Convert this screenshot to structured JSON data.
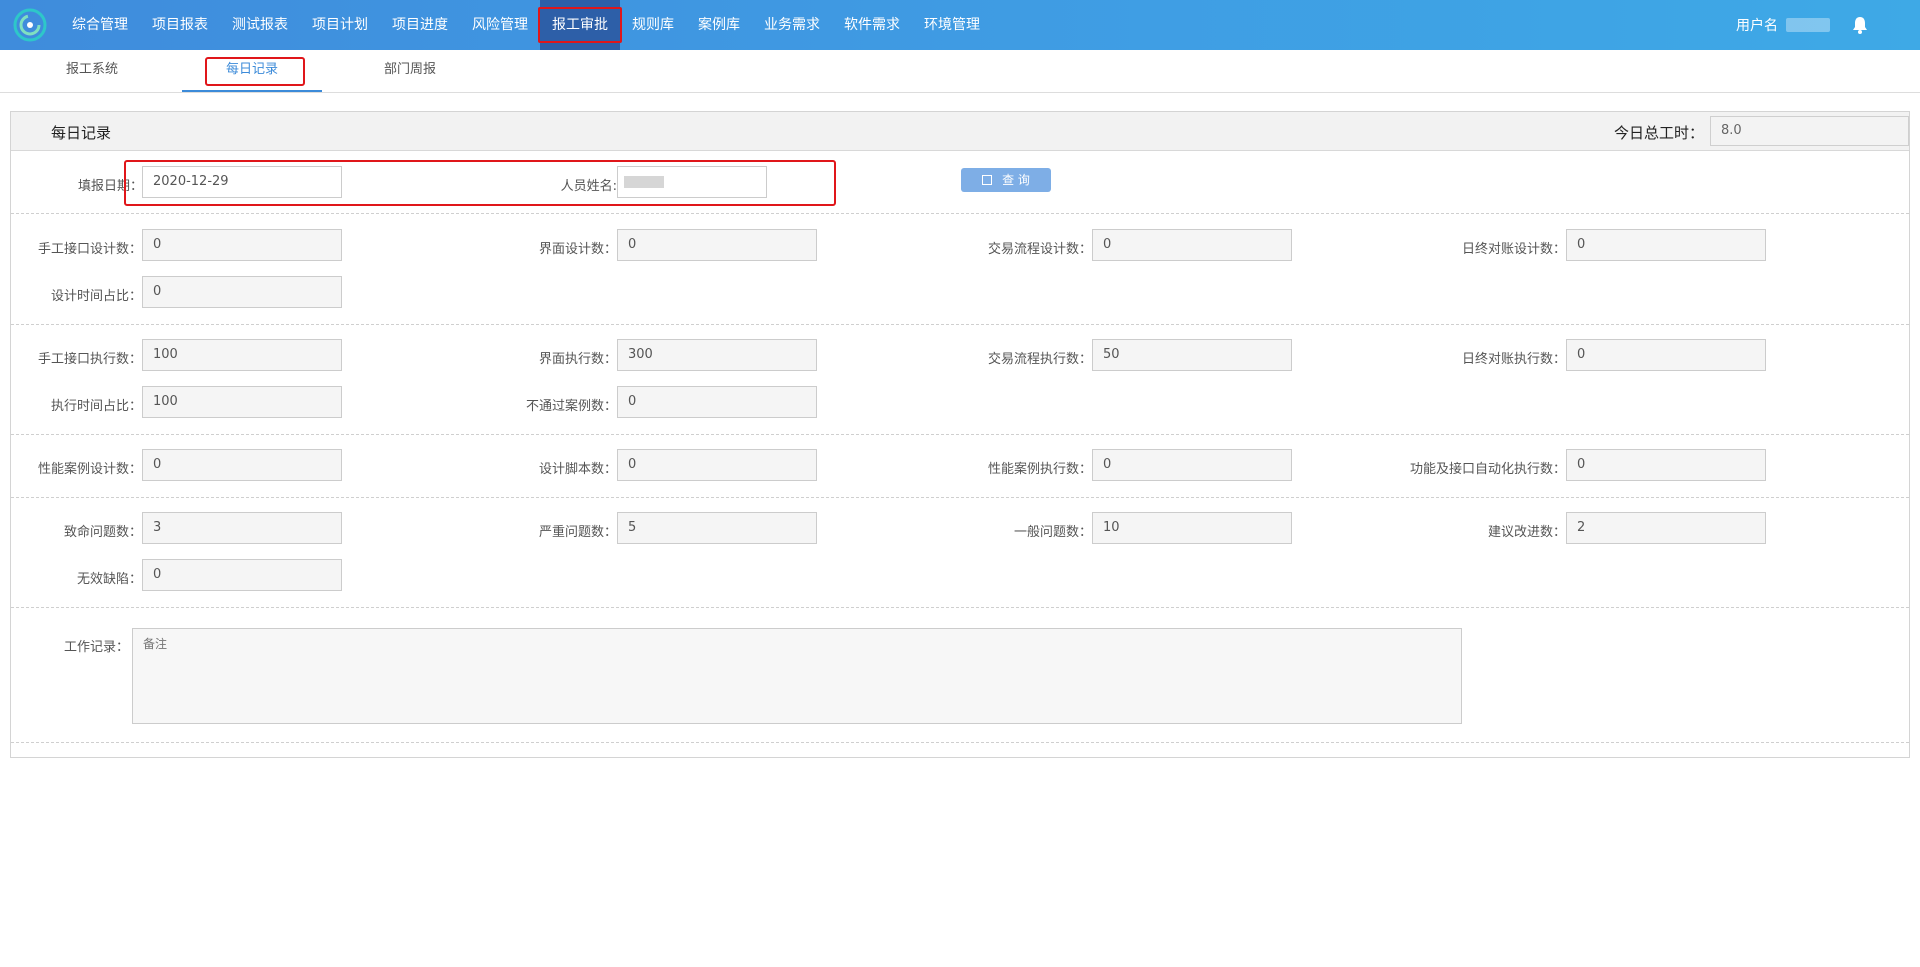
{
  "nav": {
    "items": [
      "综合管理",
      "项目报表",
      "测试报表",
      "项目计划",
      "项目进度",
      "风险管理",
      "报工审批",
      "规则库",
      "案例库",
      "业务需求",
      "软件需求",
      "环境管理"
    ],
    "active": "报工审批",
    "username_label": "用户名"
  },
  "subtabs": [
    "报工系统",
    "每日记录",
    "部门周报"
  ],
  "panel": {
    "title": "每日记录",
    "total_label": "今日总工时：",
    "total_value": "8.0"
  },
  "query": {
    "date_label": "填报日期：",
    "date_value": "2020-12-29",
    "name_label": "人员姓名:",
    "button_label": "查 询"
  },
  "design": {
    "manual_interface_label": "手工接口设计数：",
    "manual_interface_value": "0",
    "ui_label": "界面设计数：",
    "ui_value": "0",
    "flow_label": "交易流程设计数：",
    "flow_value": "0",
    "eod_label": "日终对账设计数：",
    "eod_value": "0",
    "time_ratio_label": "设计时间占比：",
    "time_ratio_value": "0"
  },
  "execute": {
    "manual_interface_label": "手工接口执行数：",
    "manual_interface_value": "100",
    "ui_label": "界面执行数：",
    "ui_value": "300",
    "flow_label": "交易流程执行数：",
    "flow_value": "50",
    "eod_label": "日终对账执行数：",
    "eod_value": "0",
    "time_ratio_label": "执行时间占比：",
    "time_ratio_value": "100",
    "failed_label": "不通过案例数：",
    "failed_value": "0"
  },
  "perf": {
    "perf_design_label": "性能案例设计数：",
    "perf_design_value": "0",
    "script_label": "设计脚本数：",
    "script_value": "0",
    "perf_exec_label": "性能案例执行数：",
    "perf_exec_value": "0",
    "auto_label": "功能及接口自动化执行数：",
    "auto_value": "0"
  },
  "issues": {
    "fatal_label": "致命问题数：",
    "fatal_value": "3",
    "severe_label": "严重问题数：",
    "severe_value": "5",
    "general_label": "一般问题数：",
    "general_value": "10",
    "suggest_label": "建议改进数：",
    "suggest_value": "2",
    "invalid_label": "无效缺陷：",
    "invalid_value": "0"
  },
  "work": {
    "label": "工作记录：",
    "placeholder": "备注"
  }
}
